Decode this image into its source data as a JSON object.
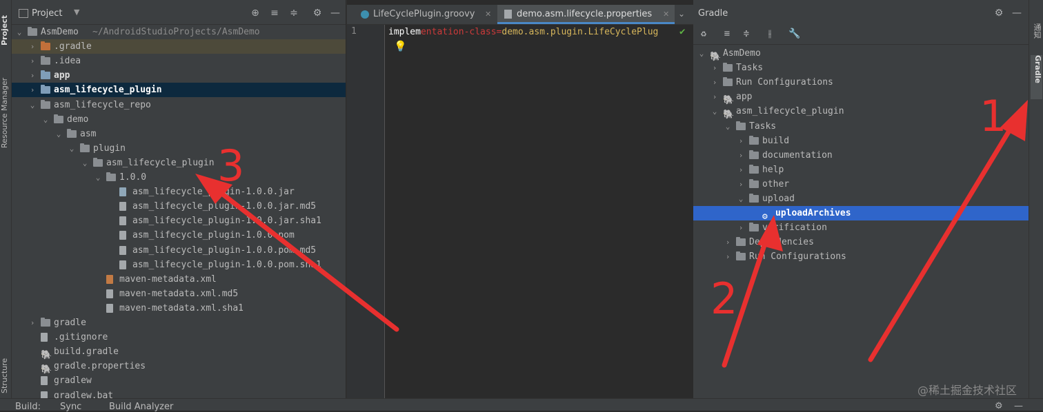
{
  "left_strip": {
    "project_tab": "Project",
    "resource_tab": "Resource Manager",
    "structure_tab": "Structure"
  },
  "project_panel": {
    "title": "Project",
    "tree": [
      {
        "label": "AsmDemo",
        "path": "~/AndroidStudioProjects/AsmDemo",
        "depth": 0,
        "expanded": true,
        "kind": "module"
      },
      {
        "label": ".gradle",
        "depth": 1,
        "expanded": false,
        "kind": "folder-orange"
      },
      {
        "label": ".idea",
        "depth": 1,
        "expanded": false,
        "kind": "folder"
      },
      {
        "label": "app",
        "depth": 1,
        "expanded": false,
        "kind": "folder-blue",
        "bold": true
      },
      {
        "label": "asm_lifecycle_plugin",
        "depth": 1,
        "expanded": false,
        "kind": "folder-blue",
        "bold": true,
        "selected": true
      },
      {
        "label": "asm_lifecycle_repo",
        "depth": 1,
        "expanded": true,
        "kind": "folder"
      },
      {
        "label": "demo",
        "depth": 2,
        "expanded": true,
        "kind": "folder"
      },
      {
        "label": "asm",
        "depth": 3,
        "expanded": true,
        "kind": "folder"
      },
      {
        "label": "plugin",
        "depth": 4,
        "expanded": true,
        "kind": "folder"
      },
      {
        "label": "asm_lifecycle_plugin",
        "depth": 5,
        "expanded": true,
        "kind": "folder"
      },
      {
        "label": "1.0.0",
        "depth": 6,
        "expanded": true,
        "kind": "folder"
      },
      {
        "label": "asm_lifecycle_plugin-1.0.0.jar",
        "depth": 7,
        "kind": "file-jar"
      },
      {
        "label": "asm_lifecycle_plugin-1.0.0.jar.md5",
        "depth": 7,
        "kind": "file"
      },
      {
        "label": "asm_lifecycle_plugin-1.0.0.jar.sha1",
        "depth": 7,
        "kind": "file"
      },
      {
        "label": "asm_lifecycle_plugin-1.0.0.pom",
        "depth": 7,
        "kind": "file"
      },
      {
        "label": "asm_lifecycle_plugin-1.0.0.pom.md5",
        "depth": 7,
        "kind": "file"
      },
      {
        "label": "asm_lifecycle_plugin-1.0.0.pom.sha1",
        "depth": 7,
        "kind": "file"
      },
      {
        "label": "maven-metadata.xml",
        "depth": 6,
        "kind": "file-xml"
      },
      {
        "label": "maven-metadata.xml.md5",
        "depth": 6,
        "kind": "file"
      },
      {
        "label": "maven-metadata.xml.sha1",
        "depth": 6,
        "kind": "file"
      },
      {
        "label": "gradle",
        "depth": 1,
        "expanded": false,
        "kind": "folder"
      },
      {
        "label": ".gitignore",
        "depth": 1,
        "kind": "file"
      },
      {
        "label": "build.gradle",
        "depth": 1,
        "kind": "gradle"
      },
      {
        "label": "gradle.properties",
        "depth": 1,
        "kind": "gradle"
      },
      {
        "label": "gradlew",
        "depth": 1,
        "kind": "file"
      },
      {
        "label": "gradlew.bat",
        "depth": 1,
        "kind": "file"
      }
    ]
  },
  "editor": {
    "tabs": [
      {
        "label": "LifeCyclePlugin.groovy",
        "active": false
      },
      {
        "label": "demo.asm.lifecycle.properties",
        "active": true
      }
    ],
    "line_number": "1",
    "code": {
      "part1": "implem",
      "part2": "entation-class=",
      "part3": "demo.asm.plugin.LifeCyclePlug"
    }
  },
  "gradle_panel": {
    "title": "Gradle",
    "tree": [
      {
        "label": "AsmDemo",
        "depth": 0,
        "expanded": true,
        "kind": "elephant"
      },
      {
        "label": "Tasks",
        "depth": 1,
        "expanded": false,
        "kind": "tasks"
      },
      {
        "label": "Run Configurations",
        "depth": 1,
        "expanded": false,
        "kind": "tasks"
      },
      {
        "label": "app",
        "depth": 1,
        "expanded": false,
        "kind": "elephant"
      },
      {
        "label": "asm_lifecycle_plugin",
        "depth": 1,
        "expanded": true,
        "kind": "elephant"
      },
      {
        "label": "Tasks",
        "depth": 2,
        "expanded": true,
        "kind": "tasks"
      },
      {
        "label": "build",
        "depth": 3,
        "expanded": false,
        "kind": "tasks"
      },
      {
        "label": "documentation",
        "depth": 3,
        "expanded": false,
        "kind": "tasks"
      },
      {
        "label": "help",
        "depth": 3,
        "expanded": false,
        "kind": "tasks"
      },
      {
        "label": "other",
        "depth": 3,
        "expanded": false,
        "kind": "tasks"
      },
      {
        "label": "upload",
        "depth": 3,
        "expanded": true,
        "kind": "tasks"
      },
      {
        "label": "uploadArchives",
        "depth": 4,
        "kind": "gear",
        "selected": true
      },
      {
        "label": "verification",
        "depth": 3,
        "expanded": false,
        "kind": "tasks"
      },
      {
        "label": "Dependencies",
        "depth": 2,
        "expanded": false,
        "kind": "deps"
      },
      {
        "label": "Run Configurations",
        "depth": 2,
        "expanded": false,
        "kind": "tasks"
      }
    ]
  },
  "right_strip": {
    "top_tab": "通知",
    "gradle_tab": "Gradle"
  },
  "bottom_bar": {
    "build": "Build:",
    "sync": "Sync",
    "analyzer": "Build Analyzer"
  },
  "annotations": {
    "one": "1",
    "two": "2",
    "three": "3",
    "color": "#e8302f"
  },
  "watermark": "@稀土掘金技术社区"
}
